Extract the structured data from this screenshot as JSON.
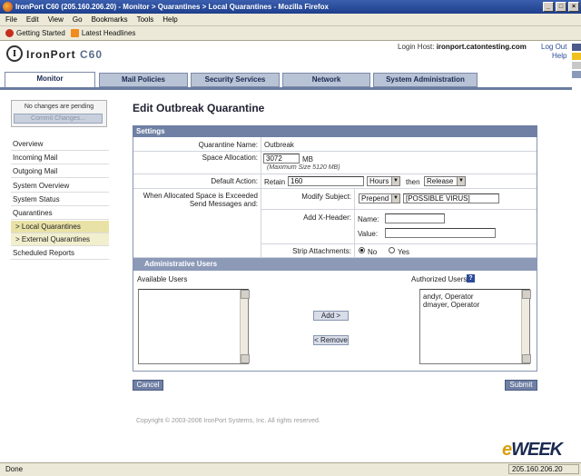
{
  "window": {
    "title": "IronPort C60 (205.160.206.20) - Monitor > Quarantines > Local Quarantines - Mozilla Firefox"
  },
  "menu": [
    "File",
    "Edit",
    "View",
    "Go",
    "Bookmarks",
    "Tools",
    "Help"
  ],
  "bookmarks": [
    "Getting Started",
    "Latest Headlines"
  ],
  "header": {
    "logo_letter": "I",
    "logo_brand": "IronPort",
    "logo_model": "C60",
    "login_label": "Login Host:",
    "login_host": "ironport.catontesting.com",
    "logout": "Log Out",
    "help": "Help"
  },
  "nav_tabs": [
    "Monitor",
    "Mail Policies",
    "Security Services",
    "Network",
    "System Administration"
  ],
  "sidebar": {
    "pending": "No changes are pending",
    "commit": "Commit Changes...",
    "items": [
      "Overview",
      "Incoming Mail",
      "Outgoing Mail",
      "System Overview",
      "System Status",
      "Quarantines",
      "> Local Quarantines",
      "> External Quarantines",
      "Scheduled Reports"
    ]
  },
  "main": {
    "title": "Edit Outbreak Quarantine",
    "settings_header": "Settings",
    "quarantine_name_label": "Quarantine Name:",
    "quarantine_name": "Outbreak",
    "space_label": "Space Allocation:",
    "space_value": "3072",
    "space_unit": "MB",
    "space_max": "(Maximum Size 5120 MB)",
    "default_action_label": "Default Action:",
    "retain_label": "Retain",
    "retain_value": "160",
    "retain_unit": "Hours",
    "then_label": "then",
    "then_action": "Release",
    "exceeded_label_1": "When Allocated Space is Exceeded",
    "exceeded_label_2": "Send Messages and:",
    "modify_subject_label": "Modify Subject:",
    "modify_subject_mode": "Prepend",
    "modify_subject_text": "[POSSIBLE VIRUS]",
    "add_header_label": "Add X-Header:",
    "name_label": "Name:",
    "value_label": "Value:",
    "strip_label": "Strip Attachments:",
    "strip_no": "No",
    "strip_yes": "Yes",
    "admin_header": "Administrative Users",
    "available_users_label": "Available Users",
    "authorized_users_label": "Authorized Users",
    "authorized_users": [
      "andyr, Operator",
      "dmayer, Operator"
    ],
    "add_button": "Add >",
    "remove_button": "< Remove",
    "cancel_button": "Cancel",
    "submit_button": "Submit"
  },
  "footer": {
    "copyright": "Copyright © 2003-2006 IronPort Systems, Inc. All rights reserved."
  },
  "watermark": {
    "e": "e",
    "rest": "WEEK"
  },
  "status": {
    "text": "Done",
    "ip": "205.160.206.20"
  },
  "colors": {
    "titlebar": "#1e3f8c",
    "nav": "#6a7ca2",
    "panel_header": "#6f80a4",
    "sidebar_highlight": "#e8e2a6"
  }
}
